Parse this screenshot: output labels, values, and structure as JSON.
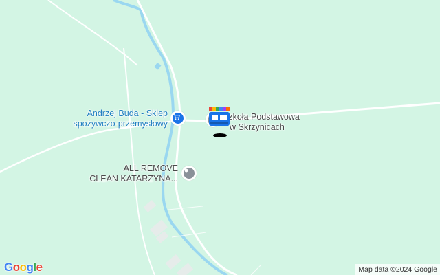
{
  "map": {
    "colors": {
      "land": "#d3f5e4",
      "road": "#ffffff",
      "river": "#9ad7f0",
      "shop": "#1a73e8",
      "generic_poi": "#8a9199"
    },
    "pois": [
      {
        "id": "shop",
        "line1": "Andrzej Buda - Sklep",
        "line2": "spożywczo-przemysłowy",
        "icon": "shopping-cart-icon"
      },
      {
        "id": "school",
        "line1": "Szkoła Podstawowa",
        "line2": "w Skrzynicach",
        "icon": "school-icon"
      },
      {
        "id": "cleaning",
        "line1": "ALL REMOVE",
        "line2": "CLEAN KATARZYNA...",
        "icon": "pin-icon"
      }
    ],
    "marker": {
      "icon": "bus-marker-icon",
      "colors": [
        "#e8453c",
        "#fbbc04",
        "#34a853",
        "#4285f4",
        "#a142f4",
        "#ff6d01"
      ]
    }
  },
  "footer": {
    "logo": "Google",
    "attribution": "Map data ©2024 Google"
  }
}
